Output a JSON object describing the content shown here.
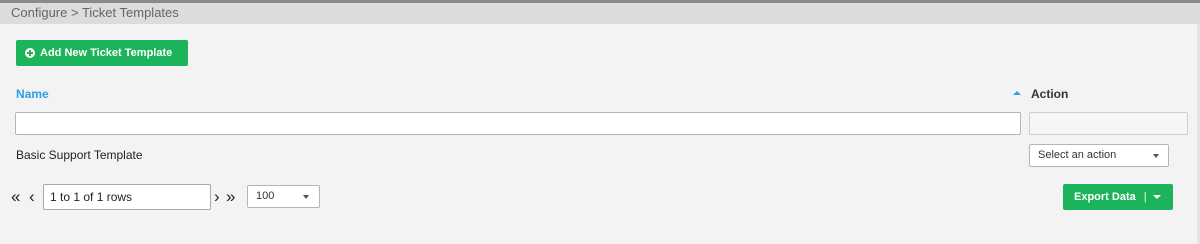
{
  "breadcrumb": {
    "path": "Configure > Ticket Templates"
  },
  "toolbar": {
    "add_label": "Add New Ticket Template"
  },
  "table": {
    "columns": {
      "name": "Name",
      "action": "Action"
    },
    "rows": [
      {
        "name": "Basic Support Template",
        "action_placeholder": "Select an action"
      }
    ]
  },
  "pagination": {
    "info": "1 to 1 of 1 rows",
    "page_size": "100",
    "first_icon": "double-chevron-left",
    "prev_icon": "chevron-left",
    "next_icon": "chevron-right",
    "last_icon": "double-chevron-right"
  },
  "export": {
    "label": "Export Data",
    "separator": "|"
  },
  "colors": {
    "accent_green": "#1bb45a",
    "link_blue": "#2d9ee0"
  }
}
